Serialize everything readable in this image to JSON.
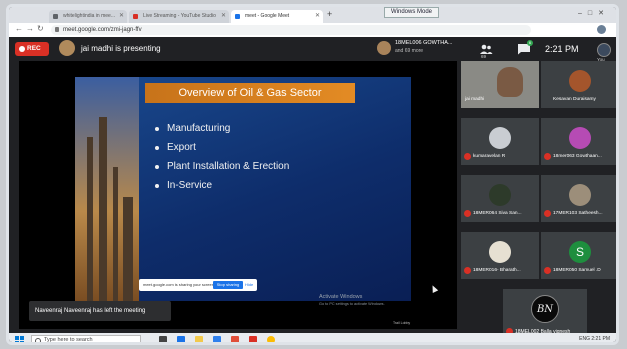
{
  "browser": {
    "tabs": [
      {
        "label": "whitelightindia in mee...",
        "color": "#5f6368"
      },
      {
        "label": "Live Streaming - YouTube Studio",
        "color": "#d93025"
      },
      {
        "label": "meet - Google Meet",
        "color": "#1a73e8"
      }
    ],
    "newtab_glyph": "+",
    "wm_label": "Windows Mode",
    "url": "meet.google.com/zmi-jagn-ffv"
  },
  "meet": {
    "rec_label": "REC",
    "presenter_text": "jai madhi is presenting",
    "pinned": {
      "name": "18MEL006 GOWTHA...",
      "more": "and 69 more"
    },
    "people_label": "69",
    "chat_badge": "6",
    "clock": "2:21 PM",
    "you_label": "You"
  },
  "slide": {
    "title": "Overview of Oil & Gas Sector",
    "bullets": [
      "Manufacturing",
      "Export",
      "Plant Installation & Erection",
      "In-Service"
    ],
    "share_text": "meet.google.com is sharing your screen.",
    "stop_label": "Stop sharing",
    "hide_label": "Hide",
    "activate_title": "Activate Windows",
    "activate_sub": "Go to PC settings to activate Windows.",
    "foot": "Trail Lobby"
  },
  "toast": "Naveenraj Naveenraj has left the meeting",
  "participants": [
    {
      "name": "jai madhi",
      "color": "#8a8a85"
    },
    {
      "name": "Kesavan Duraisamy",
      "color": "#a4552c"
    },
    {
      "name": "kumaravelan R",
      "color": "#c9cdd2"
    },
    {
      "name": "18mer063 Gowthaan...",
      "color": "#b64bb4"
    },
    {
      "name": "18MER064 Siva San...",
      "color": "#2d3a2a"
    },
    {
      "name": "17MER103 Satheesh...",
      "color": "#9c8e7a"
    },
    {
      "name": "18MER016- Bharath...",
      "color": "#e6e0d2"
    },
    {
      "name": "18MER050 Samuel .D",
      "color": "#1e8e3e"
    }
  ],
  "big_participant": {
    "name": "18MEL002 Balla vignesh",
    "logo": "BN"
  },
  "s_letter": "S",
  "taskbar": {
    "search_placeholder": "Type here to search",
    "tray": "ENG  2:21 PM"
  }
}
